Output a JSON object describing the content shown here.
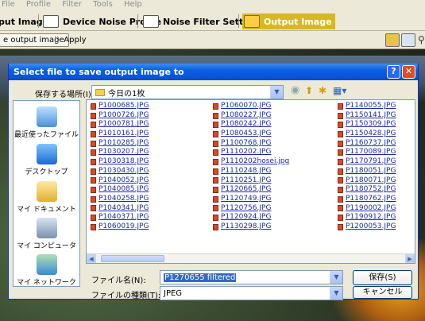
{
  "menu": [
    "File",
    "Profile",
    "Filter",
    "Tools",
    "Help"
  ],
  "tabs": [
    {
      "label": "put Image",
      "active": false
    },
    {
      "label": "Device Noise Profile",
      "active": false
    },
    {
      "label": "Noise Filter Settings",
      "active": false
    },
    {
      "label": "Output Image",
      "active": true
    }
  ],
  "toolbar": {
    "save_label": "e output image",
    "apply_label": "Apply"
  },
  "dialog": {
    "title": "Select file to save output image to",
    "save_in_label": "保存する場所(I):",
    "save_in_value": "今日の1枚",
    "places": [
      "最近使ったファイル",
      "デスクトップ",
      "マイ ドキュメント",
      "マイ コンピュータ",
      "マイ ネットワーク"
    ],
    "files_col1": [
      "P1000685.JPG",
      "P1000726.JPG",
      "P1000781.JPG",
      "P1010161.JPG",
      "P1010285.JPG",
      "P1030207.JPG",
      "P1030318.JPG",
      "P1030430.JPG",
      "P1040052.JPG",
      "P1040085.JPG",
      "P1040258.JPG",
      "P1040341.JPG",
      "P1040371.JPG",
      "P1060019.JPG"
    ],
    "files_col2": [
      "P1060070.JPG",
      "P1080227.JPG",
      "P1080242.JPG",
      "P1080453.JPG",
      "P1100768.JPG",
      "P1110202.JPG",
      "P1110202hosei.jpg",
      "P1110248.JPG",
      "P1110251.JPG",
      "P1120665.JPG",
      "P1120749.JPG",
      "P1120756.JPG",
      "P1120924.JPG",
      "P1130298.JPG"
    ],
    "files_col3": [
      "P1140055.JPG",
      "P1150141.JPG",
      "P1150309.JPG",
      "P1150428.JPG",
      "P1160737.JPG",
      "P1170089.JPG",
      "P1170791.JPG",
      "P1180051.JPG",
      "P1180071.JPG",
      "P1180752.JPG",
      "P1180762.JPG",
      "P1190002.JPG",
      "P1190912.JPG",
      "P1200053.JPG"
    ],
    "filename_label": "ファイル名(N):",
    "filename_value": "P1270655 filtered",
    "filetype_label": "ファイルの種類(T):",
    "filetype_value": "JPEG",
    "save_button": "保存(S)",
    "cancel_button": "キャンセル"
  }
}
